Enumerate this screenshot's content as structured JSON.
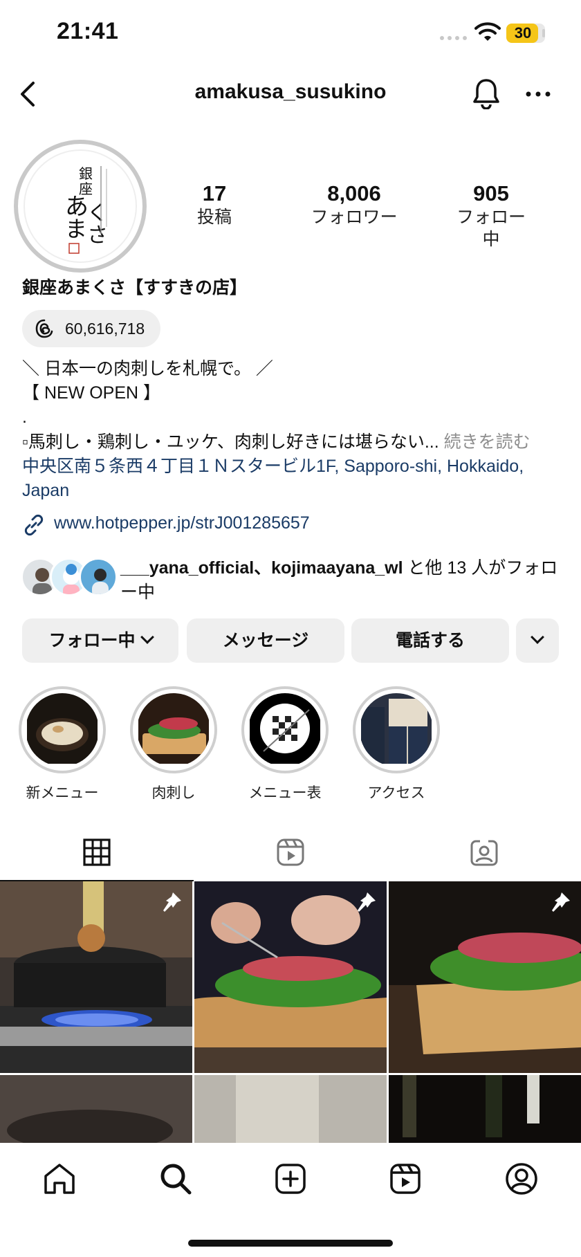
{
  "status_bar": {
    "time": "21:41",
    "battery_level": "30"
  },
  "header": {
    "username": "amakusa_susukino",
    "icons": [
      "back-icon",
      "bell-icon",
      "more-icon"
    ]
  },
  "profile": {
    "stats": [
      {
        "number": "17",
        "label": "投稿"
      },
      {
        "number": "8,006",
        "label": "フォロワー"
      },
      {
        "number": "905",
        "label": "フォロー中"
      }
    ],
    "display_name": "銀座あまくさ【すすきの店】",
    "threads_count": "60,616,718",
    "bio": {
      "line1": "＼ 日本一の肉刺しを札幌で。 ／",
      "line2": "【 NEW OPEN 】",
      "line3": ".",
      "line4": "▫馬刺し・鶏刺し・ユッケ、肉刺し好きには堪らない...",
      "more": " 続きを読む",
      "address_line1": "中央区南５条西４丁目１Ｎスタービル1F, Sapporo-shi, Hokkaido,",
      "address_line2": "Japan"
    },
    "link": "www.hotpepper.jp/strJ001285657",
    "followed_by": {
      "names": "___yana_official、kojimaayana_wl",
      "suffix": " と他 13 人がフォロー中"
    }
  },
  "buttons": {
    "following": "フォロー中",
    "message": "メッセージ",
    "call": "電話する"
  },
  "highlights": [
    {
      "label": "新メニュー"
    },
    {
      "label": "肉刺し"
    },
    {
      "label": "メニュー表"
    },
    {
      "label": "アクセス"
    }
  ],
  "tabs": [
    "grid-icon",
    "reels-icon",
    "tagged-icon"
  ],
  "bottom_nav": [
    "home-icon",
    "search-icon",
    "create-icon",
    "reels-icon",
    "profile-icon"
  ]
}
